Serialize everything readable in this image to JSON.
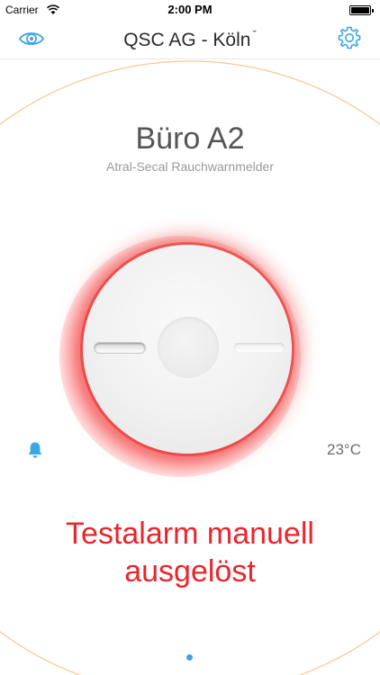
{
  "status_bar": {
    "carrier": "Carrier",
    "time": "2:00 PM"
  },
  "nav": {
    "title": "QSC AG - Köln",
    "title_chevron": "ˇ",
    "left_icon": "eye-icon",
    "right_icon": "gear-icon"
  },
  "device": {
    "room_name": "Büro A2",
    "device_type": "Atral-Secal Rauchwarnmelder",
    "temperature": "23°C",
    "alert_icon": "bell-icon",
    "status_message": "Testalarm manuell ausgelöst"
  },
  "pager": {
    "page_count": 1,
    "current_page": 1
  },
  "colors": {
    "accent_blue": "#3aa7e6",
    "alarm_red": "#e8262b",
    "ring_orange": "#f7b36b"
  }
}
